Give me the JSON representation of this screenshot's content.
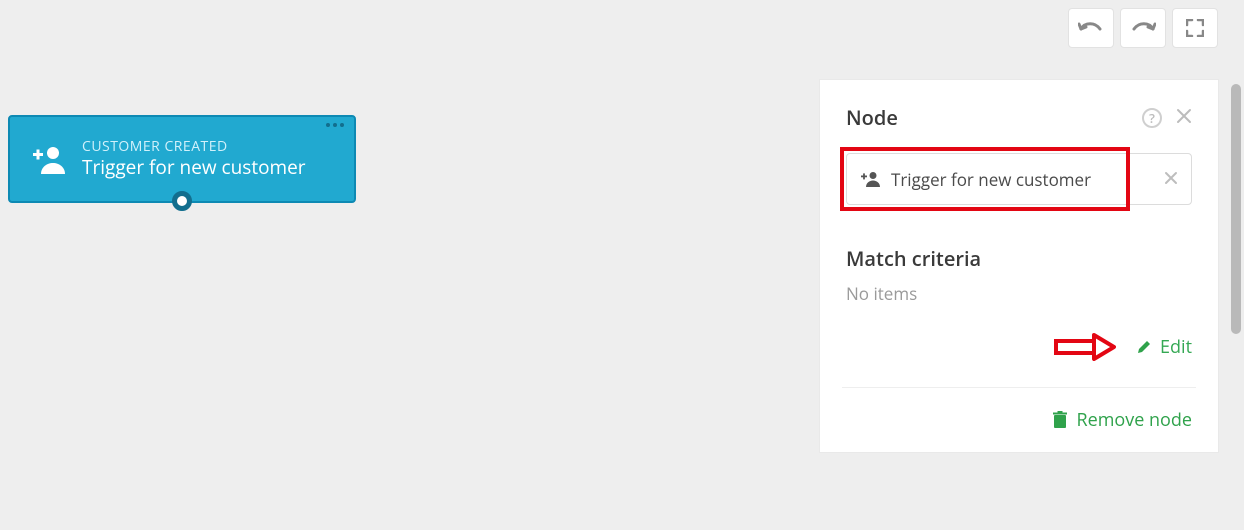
{
  "canvas": {
    "node": {
      "type_label": "CUSTOMER CREATED",
      "title": "Trigger for new customer"
    }
  },
  "panel": {
    "header_title": "Node",
    "node_name": "Trigger for new customer",
    "match_criteria_title": "Match criteria",
    "match_criteria_empty": "No items",
    "edit_label": "Edit",
    "remove_label": "Remove node"
  }
}
